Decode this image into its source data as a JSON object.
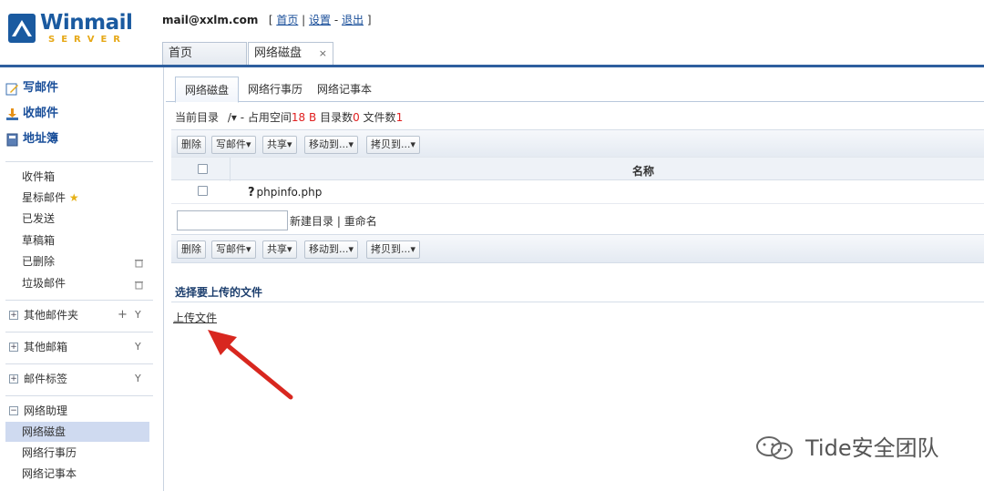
{
  "header": {
    "logo_word": "Winmail",
    "logo_sub": "SERVER",
    "email": "mail@xxlm.com",
    "link_home": "首页",
    "link_settings": "设置",
    "link_logout": "退出",
    "open_tabs": [
      "首页",
      "网络磁盘"
    ],
    "close_symbol": "×"
  },
  "sidebar": {
    "compose": "写邮件",
    "receive": "收邮件",
    "addressbook": "地址簿",
    "folders": [
      "收件箱",
      "星标邮件",
      "已发送",
      "草稿箱",
      "已删除",
      "垃圾邮件"
    ],
    "groups": [
      "其他邮件夹",
      "其他邮箱",
      "邮件标签",
      "网络助理"
    ],
    "assistant_items": [
      "网络磁盘",
      "网络行事历",
      "网络记事本"
    ],
    "selected_item": "网络磁盘"
  },
  "content": {
    "tabs": [
      "网络磁盘",
      "网络行事历",
      "网络记事本"
    ],
    "path_label": "当前目录",
    "path_value": "/▾",
    "space_label": " - 占用空间",
    "space_value": "18 B",
    "dir_label": "目录数",
    "dir_value": "0",
    "file_label": "文件数",
    "file_value": "1",
    "toolbar": [
      "删除",
      "写邮件▾",
      "共享▾",
      "移动到...▾",
      "拷贝到...▾"
    ],
    "col_name": "名称",
    "files": [
      {
        "name": "phpinfo.php"
      }
    ],
    "new_dir": "新建目录",
    "rename": "重命名",
    "upload_title": "选择要上传的文件",
    "upload_link": "上传文件"
  },
  "watermark": "Tide安全团队",
  "colors": {
    "brand": "#1a5aa0",
    "header_rule": "#2e5f9e",
    "selected": "#cfdaf0",
    "arrow": "#d8271f"
  }
}
